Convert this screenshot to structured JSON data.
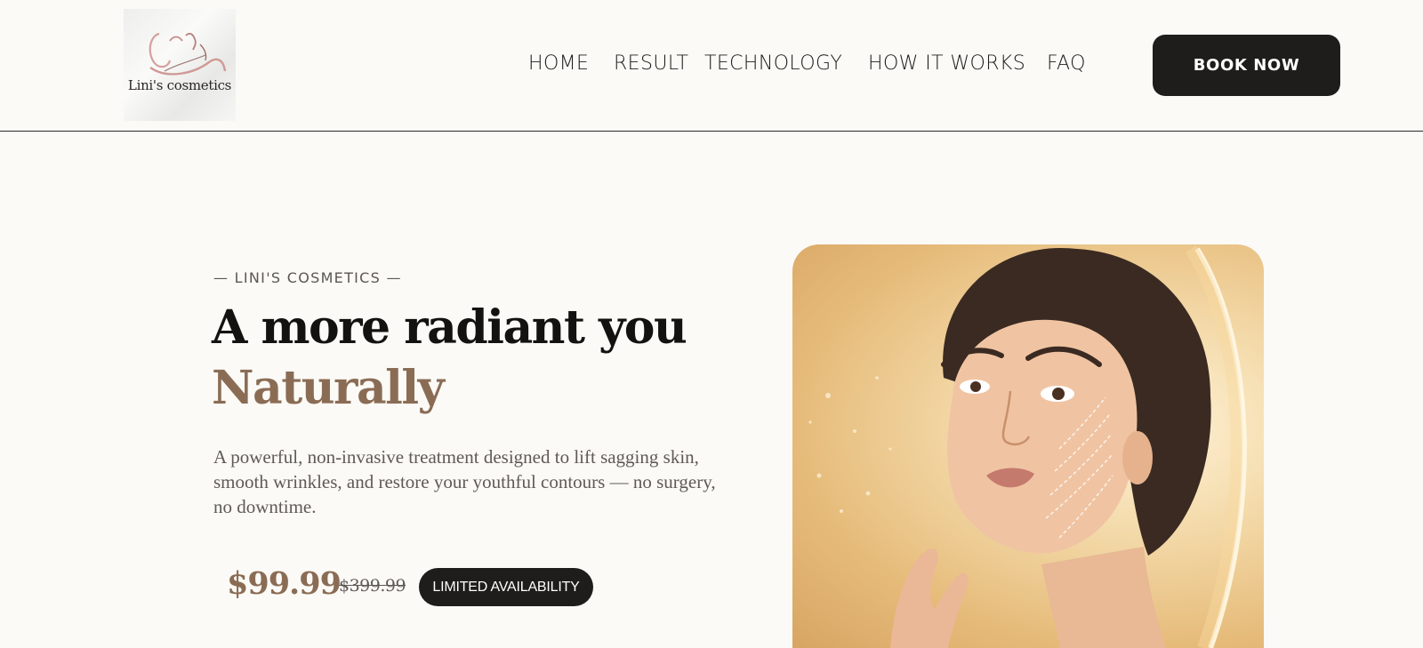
{
  "brand": {
    "logo_text": "Lini's cosmetics",
    "logo_icon": "face-line-art-icon"
  },
  "nav": {
    "items": [
      {
        "label": "HOME"
      },
      {
        "label": "RESULT"
      },
      {
        "label": "TECHNOLOGY"
      },
      {
        "label": "HOW IT WORKS"
      },
      {
        "label": "FAQ"
      }
    ],
    "cta_label": "BOOK NOW"
  },
  "hero": {
    "eyebrow": "— LINI'S COSMETICS —",
    "headline": "A more radiant you",
    "headline_accent": "Naturally",
    "description": "A powerful, non-invasive treatment designed to lift sagging skin, smooth wrinkles, and restore your youthful contours — no surgery, no downtime.",
    "price": "$99.99",
    "old_price": "$399.99",
    "badge": "LIMITED AVAILABILITY"
  },
  "colors": {
    "background": "#fbfaf6",
    "dark": "#1f1d1b",
    "accent": "#8a6c55",
    "text_muted": "#5f5a55"
  }
}
